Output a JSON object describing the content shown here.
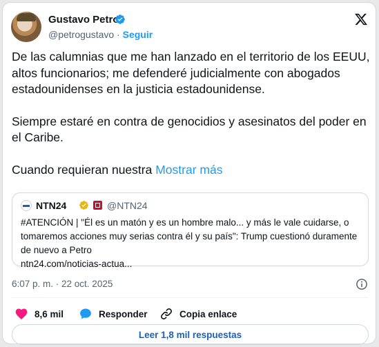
{
  "author": {
    "name": "Gustavo Petro",
    "handle": "@petrogustavo",
    "separator": "·",
    "follow_label": "Seguir"
  },
  "tweet": {
    "paragraph1": "De las calumnias que me han lanzado en el territorio de los EEUU, altos funcionarios; me defenderé judicialmente con abogados estadounidenses en la justicia estadounidense.",
    "paragraph2": "Siempre estaré en contra de genocidios y asesinatos del poder en el Caribe.",
    "paragraph3": "Cuando requieran nuestra",
    "show_more_label": "Mostrar más"
  },
  "quote": {
    "name": "NTN24",
    "handle": "@NTN24",
    "text": "#ATENCIÓN | \"Él es un matón y es un hombre malo... y más le vale cuidarse, o tomaremos acciones muy serias contra él y su país\": Trump cuestionó duramente de nuevo a Petro",
    "link": "ntn24.com/noticias-actua..."
  },
  "timestamp": "6:07 p. m. · 22 oct. 2025",
  "actions": {
    "likes": "8,6 mil",
    "reply_label": "Responder",
    "copy_link_label": "Copia enlace"
  },
  "replies_button_label": "Leer 1,8 mil respuestas",
  "colors": {
    "accent": "#1d9bf0",
    "like": "#f91880",
    "verified_blue": "#1d9bf0",
    "verified_gold": "#e2b719"
  },
  "icons": [
    "x-logo-icon",
    "verified-badge-icon",
    "gold-verified-badge-icon",
    "flag-badge-icon",
    "info-icon",
    "heart-icon",
    "reply-bubble-icon",
    "link-icon"
  ]
}
